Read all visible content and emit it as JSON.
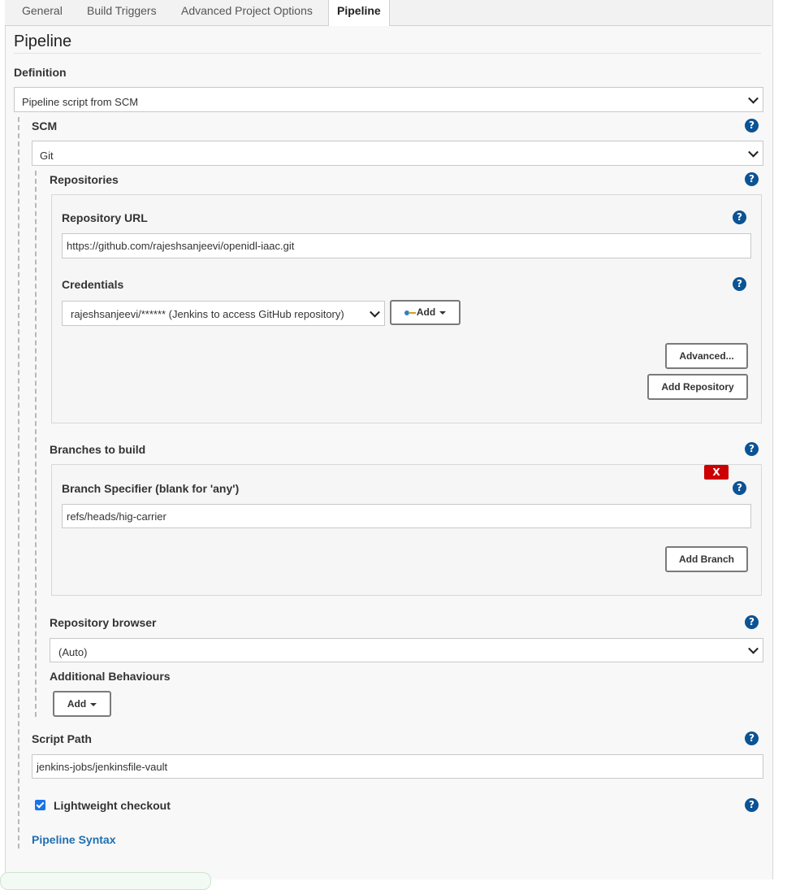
{
  "tabs": [
    {
      "label": "General"
    },
    {
      "label": "Build Triggers"
    },
    {
      "label": "Advanced Project Options"
    },
    {
      "label": "Pipeline",
      "active": true
    }
  ],
  "section_title": "Pipeline",
  "definition": {
    "label": "Definition",
    "selected": "Pipeline script from SCM"
  },
  "scm": {
    "label": "SCM",
    "selected": "Git"
  },
  "repositories": {
    "label": "Repositories",
    "repo_url_label": "Repository URL",
    "repo_url_value": "https://github.com/rajeshsanjeevi/openidl-iaac.git",
    "credentials_label": "Credentials",
    "credentials_selected": "rajeshsanjeevi/****** (Jenkins to access GitHub repository)",
    "add_label": "Add",
    "advanced_label": "Advanced...",
    "add_repository_label": "Add Repository"
  },
  "branches": {
    "label": "Branches to build",
    "delete_label": "X",
    "specifier_label": "Branch Specifier (blank for 'any')",
    "specifier_value": "refs/heads/hig-carrier",
    "add_branch_label": "Add Branch"
  },
  "repo_browser": {
    "label": "Repository browser",
    "selected": "(Auto)"
  },
  "additional_behaviours": {
    "label": "Additional Behaviours",
    "add_label": "Add"
  },
  "script_path": {
    "label": "Script Path",
    "value": "jenkins-jobs/jenkinsfile-vault"
  },
  "lightweight_checkout": {
    "label": "Lightweight checkout",
    "checked": true
  },
  "pipeline_syntax_link": "Pipeline Syntax",
  "help_glyph": "?",
  "colors": {
    "help": "#0b5394",
    "link": "#1f6fb2",
    "delete": "#cc0000",
    "checkbox": "#1a73e8"
  },
  "icons": [
    "chevron-down-icon",
    "help-icon",
    "key-icon",
    "caret-down-icon",
    "checkbox-checked-icon"
  ]
}
